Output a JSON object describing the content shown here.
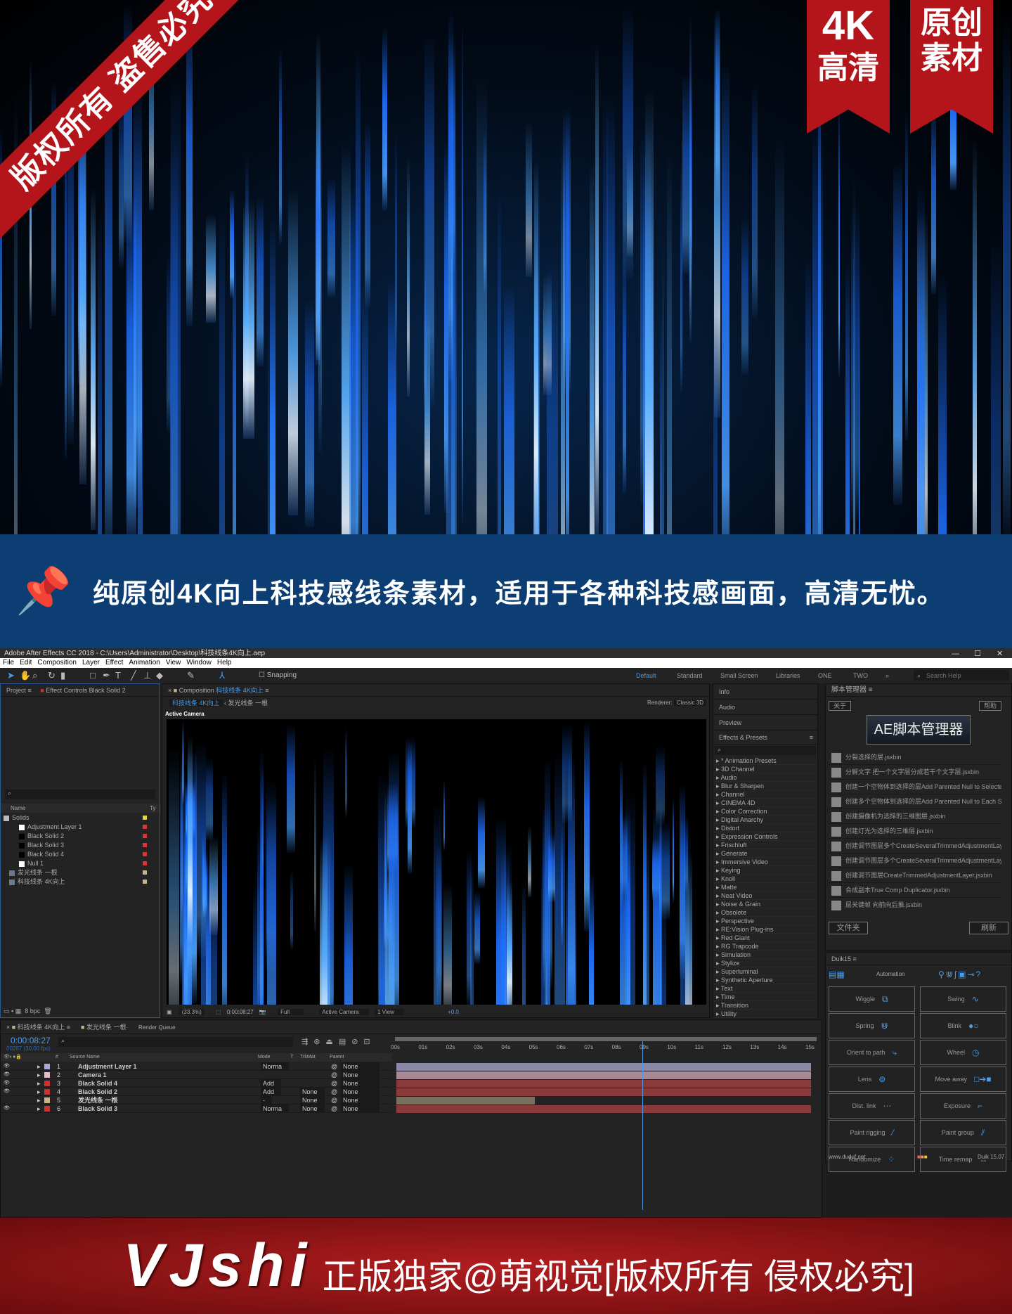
{
  "hero": {
    "corner_banner": "版权所有 盗售必究",
    "ribbon1": {
      "line1": "4K",
      "line2": "高清"
    },
    "ribbon2": {
      "line1": "原创",
      "line2": "素材"
    },
    "accent": "#b3151b"
  },
  "banner": {
    "icon": "pushpin-icon",
    "text": "纯原创4K向上科技感线条素材，适用于各种科技感画面，高清无忧。",
    "bg": "#0c3e73"
  },
  "window": {
    "title": "Adobe After Effects CC 2018 - C:\\Users\\Administrator\\Desktop\\科技线条4K向上.aep",
    "controls": [
      "—",
      "☐",
      "✕"
    ]
  },
  "menu": [
    "File",
    "Edit",
    "Composition",
    "Layer",
    "Effect",
    "Animation",
    "View",
    "Window",
    "Help"
  ],
  "toolbar": {
    "snapping": "Snapping",
    "workspaces": [
      "Default",
      "Standard",
      "Small Screen",
      "Libraries",
      "ONE",
      "TWO"
    ],
    "more": "»",
    "search_placeholder": "Search Help"
  },
  "project": {
    "tab": "Project",
    "tab2": "Effect Controls Black Solid 2",
    "search_placeholder": "",
    "col_name": "Name",
    "col_type": "Ty",
    "items": [
      {
        "name": "Solids",
        "color": "#e8d23a",
        "kind": "folder"
      },
      {
        "name": "Adjustment Layer 1",
        "color": "#d33",
        "kind": "white"
      },
      {
        "name": "Black Solid 2",
        "color": "#d33",
        "kind": "black"
      },
      {
        "name": "Black Solid 3",
        "color": "#d33",
        "kind": "black"
      },
      {
        "name": "Black Solid 4",
        "color": "#d33",
        "kind": "black"
      },
      {
        "name": "Null 1",
        "color": "#d33",
        "kind": "white"
      },
      {
        "name": "发光线条 一根",
        "color": "#c8b48a",
        "kind": "comp"
      },
      {
        "name": "科技线条 4K向上",
        "color": "#c8b48a",
        "kind": "comp"
      }
    ],
    "bpc": "8 bpc"
  },
  "composition": {
    "tab_prefix": "Composition",
    "tab_name": "科技线条 4K向上",
    "breadcrumb": [
      "科技线条 4K向上",
      "发光线条 一根"
    ],
    "renderer_label": "Renderer:",
    "renderer": "Classic 3D",
    "view_label": "Active Camera",
    "footer": {
      "zoom": "(33.3%)",
      "time": "0:00:08:27",
      "resolution": "Full",
      "camera": "Active Camera",
      "views": "1 View",
      "exposure": "+0.0"
    }
  },
  "side_tabs": [
    "Info",
    "Audio",
    "Preview"
  ],
  "effects": {
    "title": "Effects & Presets",
    "items": [
      "* Animation Presets",
      "3D Channel",
      "Audio",
      "Blur & Sharpen",
      "Channel",
      "CINEMA 4D",
      "Color Correction",
      "Digital Anarchy",
      "Distort",
      "Expression Controls",
      "Frischluft",
      "Generate",
      "Immersive Video",
      "Keying",
      "Knoll",
      "Matte",
      "Neat Video",
      "Noise & Grain",
      "Obsolete",
      "Perspective",
      "RE:Vision Plug-ins",
      "Red Giant",
      "RG Trapcode",
      "Simulation",
      "Stylize",
      "Superluminal",
      "Synthetic Aperture",
      "Text",
      "Time",
      "Transition",
      "Utility"
    ]
  },
  "script_manager": {
    "title": "脚本管理器",
    "about": "关于",
    "help": "帮助",
    "logo": "AE脚本管理器",
    "scripts": [
      "分裂选择的层.jsxbin",
      "分解文字 把一个文字层分成若干个文字层.jsxbin",
      "创建一个空物体到选择的层Add Parented Null to Selected L",
      "创建多个空物体到选择的层Add Parented Null to Each Selec",
      "创建摄像机为选择的三维图层.jsxbin",
      "创建灯光为选择的三维层.jsxbin",
      "创建调节图层多个CreateSeveralTrimmedAdjustmentLayers.js",
      "创建调节图层多个CreateSeveralTrimmedAdjustmentLayers.js",
      "创建调节图层CreateTrimmedAdjustmentLayer.jsxbin",
      "合成副本True Comp Duplicator.jsxbin",
      "层关键帧 向前向后推.jsxbin"
    ],
    "folder": "文件夹",
    "refresh": "刷新"
  },
  "duik": {
    "title": "Duik15",
    "section": "Automation",
    "buttons": [
      {
        "label": "Wiggle",
        "icon": "⧉"
      },
      {
        "label": "Swing",
        "icon": "∿"
      },
      {
        "label": "Spring",
        "icon": "⋓"
      },
      {
        "label": "Blink",
        "icon": "●○"
      },
      {
        "label": "Orient to path",
        "icon": "⤷"
      },
      {
        "label": "Wheel",
        "icon": "◷"
      },
      {
        "label": "Lens",
        "icon": "⊚"
      },
      {
        "label": "Move away",
        "icon": "□➔■"
      },
      {
        "label": "Dist. link",
        "icon": "⋯"
      },
      {
        "label": "Exposure",
        "icon": "⌐"
      },
      {
        "label": "Paint rigging",
        "icon": "⁄"
      },
      {
        "label": "Paint group",
        "icon": "⫽"
      },
      {
        "label": "Randomize",
        "icon": "⁘"
      },
      {
        "label": "Time remap",
        "icon": "↔"
      }
    ],
    "footer_left": "www.duduf.net",
    "footer_right": "Duik 15.07"
  },
  "timeline": {
    "tabs": [
      "科技线条 4K向上",
      "发光线条 一根",
      "Render Queue"
    ],
    "time": "0:00:08:27",
    "frames": "00267 (30.00 fps)",
    "headers": {
      "num": "#",
      "source": "Source Name",
      "mode": "Mode",
      "t": "T",
      "trkmat": "TrkMat",
      "parent": "Parent"
    },
    "ruler": [
      "00s",
      "01s",
      "02s",
      "03s",
      "04s",
      "05s",
      "06s",
      "07s",
      "08s",
      "09s",
      "10s",
      "11s",
      "12s",
      "13s",
      "14s",
      "15s"
    ],
    "playhead_seconds": 8.9,
    "layers": [
      {
        "num": "1",
        "name": "Adjustment Layer 1",
        "label": "#a9a9d6",
        "mode": "Norma",
        "trkmat": "",
        "parent": "None",
        "bar": "#8a8aa8",
        "start": 0,
        "end": 15
      },
      {
        "num": "2",
        "name": "Camera 1",
        "label": "#e6b8c8",
        "mode": "",
        "trkmat": "",
        "parent": "None",
        "bar": "#a88a94",
        "start": 0,
        "end": 15
      },
      {
        "num": "3",
        "name": "Black Solid 4",
        "label": "#c83232",
        "mode": "Add",
        "trkmat": "",
        "parent": "None",
        "bar": "#8a3a3a",
        "start": 0,
        "end": 15
      },
      {
        "num": "4",
        "name": "Black Solid 2",
        "label": "#c83232",
        "mode": "Add",
        "trkmat": "None",
        "parent": "None",
        "bar": "#8a3a3a",
        "start": 0,
        "end": 15
      },
      {
        "num": "5",
        "name": "发光线条 一根",
        "label": "#c8b48a",
        "mode": "-",
        "trkmat": "None",
        "parent": "None",
        "bar": "#7a7060",
        "start": 0,
        "end": 5
      },
      {
        "num": "6",
        "name": "Black Solid 3",
        "label": "#c83232",
        "mode": "Norma",
        "trkmat": "None",
        "parent": "None",
        "bar": "#8a3a3a",
        "start": 0,
        "end": 15
      }
    ]
  },
  "footer_banner": {
    "logo": "VJshi",
    "text": "正版独家@萌视觉[版权所有 侵权必究]"
  }
}
